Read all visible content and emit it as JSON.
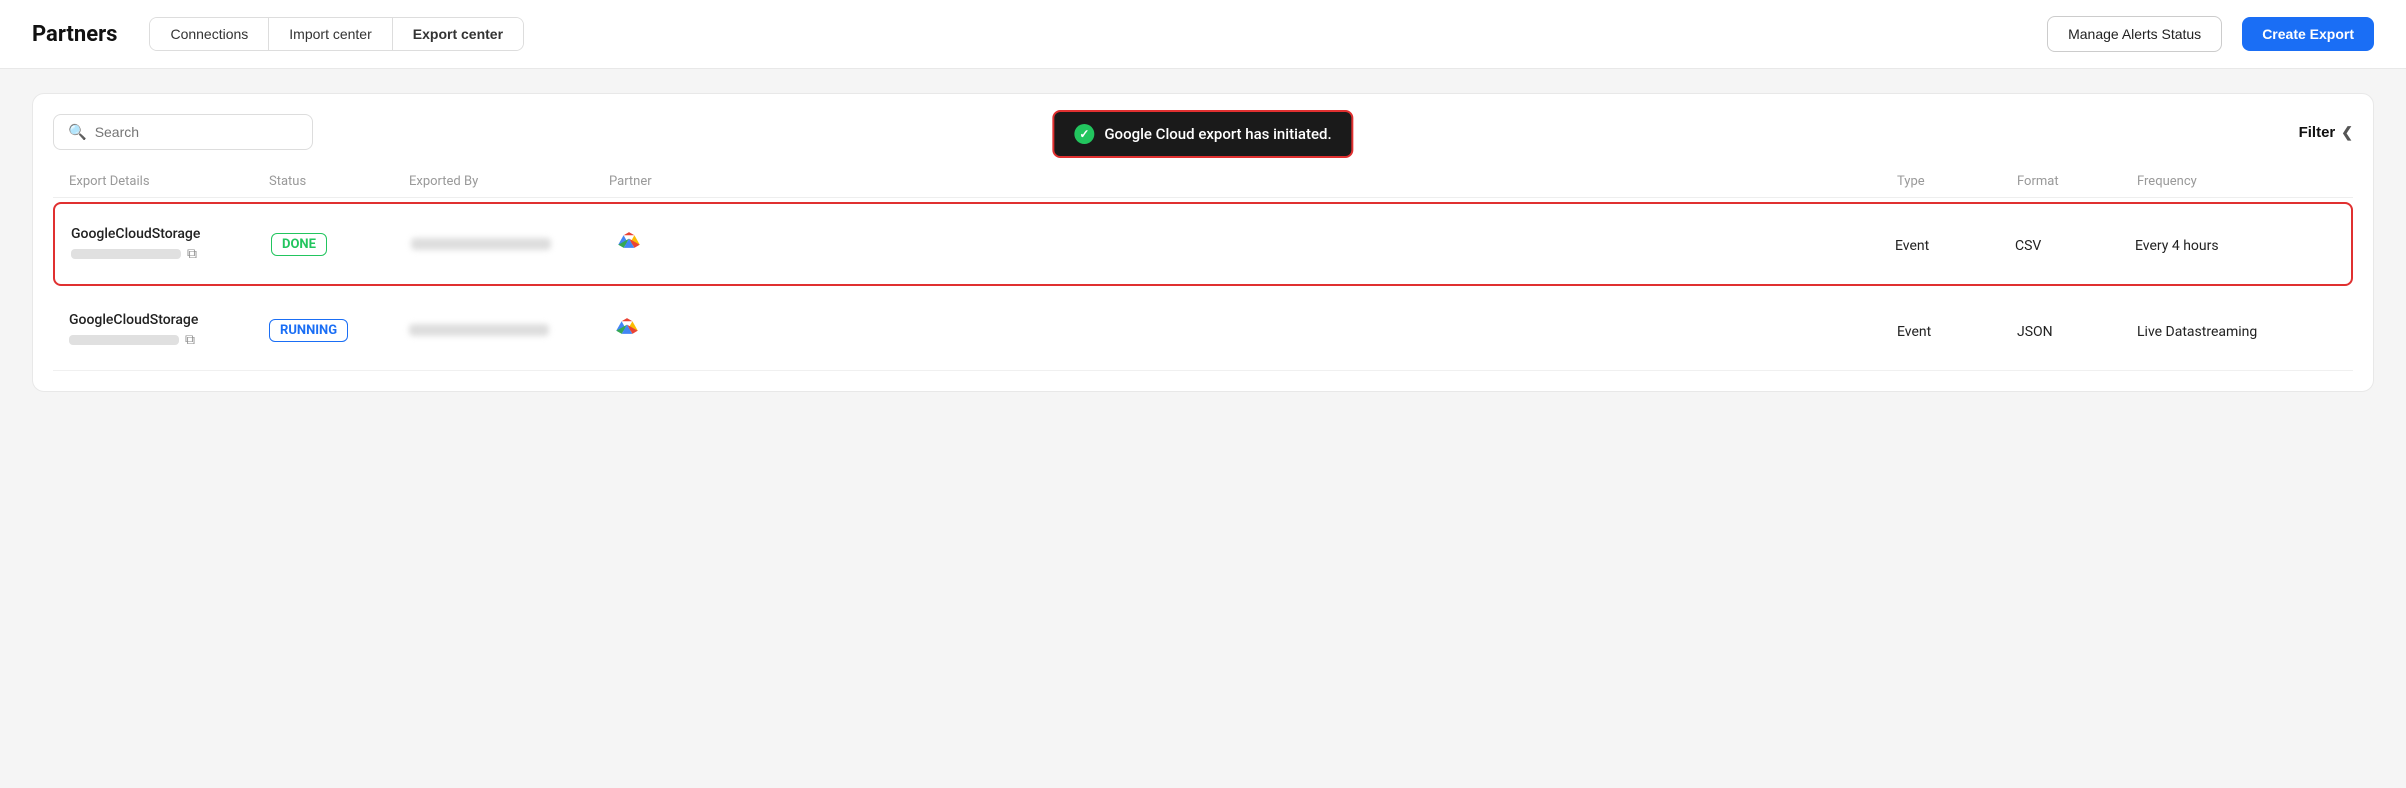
{
  "header": {
    "title": "Partners",
    "tabs": [
      {
        "label": "Connections",
        "active": false
      },
      {
        "label": "Import center",
        "active": false
      },
      {
        "label": "Export center",
        "active": true
      }
    ],
    "manage_alerts_label": "Manage Alerts Status",
    "create_export_label": "Create Export"
  },
  "toolbar": {
    "search_placeholder": "Search",
    "filter_label": "Filter"
  },
  "toast": {
    "message": "Google Cloud export has initiated."
  },
  "table": {
    "columns": [
      "Export Details",
      "Status",
      "Exported By",
      "Partner",
      "Type",
      "Format",
      "Frequency"
    ],
    "rows": [
      {
        "name": "GoogleCloudStorage",
        "status": "DONE",
        "status_type": "done",
        "type": "Event",
        "format": "CSV",
        "frequency": "Every 4 hours",
        "highlighted": true
      },
      {
        "name": "GoogleCloudStorage",
        "status": "RUNNING",
        "status_type": "running",
        "type": "Event",
        "format": "JSON",
        "frequency": "Live Datastreaming",
        "highlighted": false
      }
    ]
  }
}
